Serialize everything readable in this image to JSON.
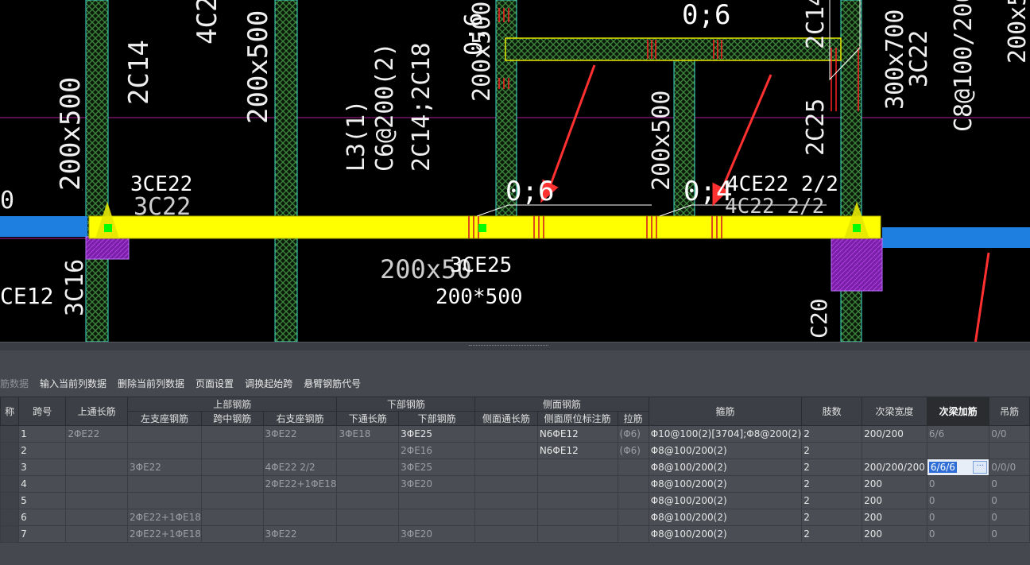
{
  "cad": {
    "labels": [
      "200x500",
      "2C14",
      "4C2",
      "3C16",
      "200x500",
      "3CE22",
      "3C22",
      "0;6",
      "200x500",
      "0;6",
      "L3(1)",
      "C6@200(2)",
      "2C14;2C18",
      "0;6",
      "200x500",
      "2C14",
      "0;4",
      "4CE22 2/2",
      "4C22 2/2",
      "2C25",
      "300x700",
      "3C22",
      "C8@100/200",
      "200x50",
      "3CE25",
      "200*500",
      "3C16",
      "CE12",
      "0",
      "C20",
      "200x5"
    ]
  },
  "toolbar": {
    "items": [
      "筋数据",
      "输入当前列数据",
      "删除当前列数据",
      "页面设置",
      "调换起始跨",
      "悬臂钢筋代号"
    ]
  },
  "table": {
    "group_headers": {
      "top": "上部钢筋",
      "bottom": "下部钢筋",
      "side": "侧面钢筋"
    },
    "headers": {
      "name": "称",
      "span": "跨号",
      "top_long": "上通长筋",
      "left_seat": "左支座钢筋",
      "mid": "跨中钢筋",
      "right_seat": "右支座钢筋",
      "bottom_long": "下通长筋",
      "bottom_bar": "下部钢筋",
      "side_long": "侧面通长筋",
      "side_orig": "侧面原位标注筋",
      "tie": "拉筋",
      "stirrup": "箍筋",
      "legs": "肢数",
      "sec_width": "次梁宽度",
      "sec_bar": "次梁加筋",
      "hanger": "吊筋"
    },
    "rows": [
      {
        "span": "1",
        "top_long": "2ΦE22",
        "left_seat": "",
        "mid": "",
        "right_seat": "3ΦE22",
        "bottom_long": "3ΦE18",
        "bottom_bar": "3ΦE25",
        "side_long": "",
        "side_orig": "N6ΦE12",
        "tie": "(Φ6)",
        "stirrup": "Φ10@100(2)[3704];Φ8@200(2)",
        "legs": "2",
        "sec_width": "200/200",
        "sec_bar": "6/6",
        "hanger": "0/0"
      },
      {
        "span": "2",
        "top_long": "",
        "left_seat": "",
        "mid": "",
        "right_seat": "",
        "bottom_long": "",
        "bottom_bar": "2ΦE16",
        "side_long": "",
        "side_orig": "N6ΦE12",
        "tie": "(Φ6)",
        "stirrup": "Φ8@100/200(2)",
        "legs": "2",
        "sec_width": "",
        "sec_bar": "",
        "hanger": ""
      },
      {
        "span": "3",
        "top_long": "",
        "left_seat": "3ΦE22",
        "mid": "",
        "right_seat": "4ΦE22 2/2",
        "bottom_long": "",
        "bottom_bar": "3ΦE25",
        "side_long": "",
        "side_orig": "",
        "tie": "",
        "stirrup": "Φ8@100/200(2)",
        "legs": "2",
        "sec_width": "200/200/200",
        "sec_bar": "6/6/6",
        "hanger": "0/0/0"
      },
      {
        "span": "4",
        "top_long": "",
        "left_seat": "",
        "mid": "",
        "right_seat": "2ΦE22+1ΦE18",
        "bottom_long": "",
        "bottom_bar": "3ΦE20",
        "side_long": "",
        "side_orig": "",
        "tie": "",
        "stirrup": "Φ8@100/200(2)",
        "legs": "2",
        "sec_width": "200",
        "sec_bar": "0",
        "hanger": "0"
      },
      {
        "span": "5",
        "top_long": "",
        "left_seat": "",
        "mid": "",
        "right_seat": "",
        "bottom_long": "",
        "bottom_bar": "",
        "side_long": "",
        "side_orig": "",
        "tie": "",
        "stirrup": "Φ8@100/200(2)",
        "legs": "2",
        "sec_width": "200",
        "sec_bar": "0",
        "hanger": "0"
      },
      {
        "span": "6",
        "top_long": "",
        "left_seat": "2ΦE22+1ΦE18",
        "mid": "",
        "right_seat": "",
        "bottom_long": "",
        "bottom_bar": "",
        "side_long": "",
        "side_orig": "",
        "tie": "",
        "stirrup": "Φ8@100/200(2)",
        "legs": "2",
        "sec_width": "200",
        "sec_bar": "0",
        "hanger": "0"
      },
      {
        "span": "7",
        "top_long": "",
        "left_seat": "2ΦE22+1ΦE18",
        "mid": "",
        "right_seat": "3ΦE22",
        "bottom_long": "",
        "bottom_bar": "3ΦE20",
        "side_long": "",
        "side_orig": "",
        "tie": "",
        "stirrup": "Φ8@100/200(2)",
        "legs": "2",
        "sec_width": "200",
        "sec_bar": "0",
        "hanger": "0"
      }
    ],
    "edit_btn": "···"
  }
}
